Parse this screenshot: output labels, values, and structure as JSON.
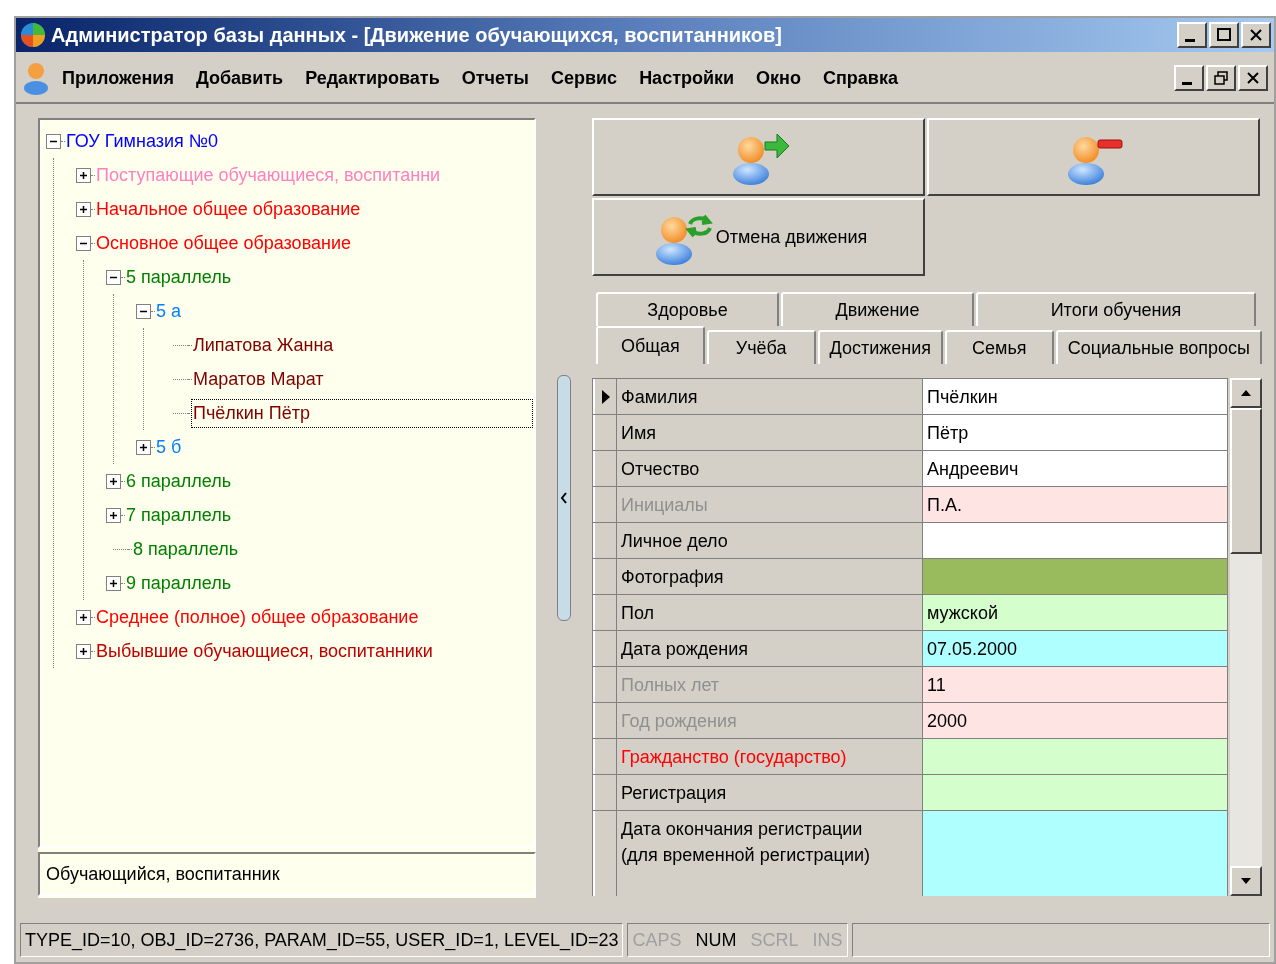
{
  "window": {
    "title": "Администратор базы данных - [Движение обучающихся, воспитанников]"
  },
  "menu": [
    "Приложения",
    "Добавить",
    "Редактировать",
    "Отчеты",
    "Сервис",
    "Настройки",
    "Окно",
    "Справка"
  ],
  "tree": [
    {
      "label": "ГОУ Гимназия №0",
      "color": "#0000ff",
      "expanded": true,
      "selected": false,
      "children": [
        {
          "label": "Поступающие обучающиеся, воспитанни",
          "color": "#ff80c0",
          "expanded": false,
          "selected": false
        },
        {
          "label": "Начальное общее образование",
          "color": "#ff0000",
          "expanded": false,
          "selected": false
        },
        {
          "label": "Основное общее образование",
          "color": "#ff0000",
          "expanded": true,
          "selected": false,
          "children": [
            {
              "label": "5 параллель",
              "color": "#008000",
              "expanded": true,
              "selected": false,
              "children": [
                {
                  "label": "5 а",
                  "color": "#0080ff",
                  "expanded": true,
                  "selected": false,
                  "children": [
                    {
                      "label": "Липатова Жанна",
                      "color": "#800000",
                      "selected": false
                    },
                    {
                      "label": "Маратов Марат",
                      "color": "#800000",
                      "selected": false
                    },
                    {
                      "label": "Пчёлкин Пётр",
                      "color": "#800000",
                      "selected": true
                    }
                  ]
                },
                {
                  "label": "5 б",
                  "color": "#0080ff",
                  "expanded": false,
                  "selected": false
                }
              ]
            },
            {
              "label": "6 параллель",
              "color": "#008000",
              "expanded": false,
              "selected": false
            },
            {
              "label": "7 параллель",
              "color": "#008000",
              "expanded": false,
              "selected": false
            },
            {
              "label": "8 параллель",
              "color": "#008000",
              "selected": false
            },
            {
              "label": "9 параллель",
              "color": "#008000",
              "expanded": false,
              "selected": false
            }
          ]
        },
        {
          "label": "Среднее (полное) общее образование",
          "color": "#ff0000",
          "expanded": false,
          "selected": false
        },
        {
          "label": "Выбывшие обучающиеся, воспитанники",
          "color": "#c00000",
          "expanded": false,
          "selected": false
        }
      ]
    }
  ],
  "tree_footer": {
    "value": "Обучающийся, воспитанник"
  },
  "action_buttons": [
    {
      "kind": "move"
    },
    {
      "kind": "remove"
    },
    {
      "kind": "cancel",
      "label": "Отмена движения"
    }
  ],
  "tabs_top": [
    {
      "label": "Здоровье",
      "selected": false
    },
    {
      "label": "Движение",
      "selected": false
    },
    {
      "label": "Итоги обучения",
      "selected": false
    }
  ],
  "tabs_bottom": [
    {
      "label": "Общая",
      "selected": true
    },
    {
      "label": "Учёба",
      "selected": false
    },
    {
      "label": "Достижения",
      "selected": false
    },
    {
      "label": "Семья",
      "selected": false
    },
    {
      "label": "Социальные вопросы",
      "selected": false
    }
  ],
  "fields": [
    {
      "label": "Фамилия",
      "value": "Пчёлкин",
      "kind": "normal",
      "color": "#ffffff",
      "current": true
    },
    {
      "label": "Имя",
      "value": "Пётр",
      "kind": "normal",
      "color": "#ffffff",
      "current": false
    },
    {
      "label": "Отчество",
      "value": "Андреевич",
      "kind": "normal",
      "color": "#ffffff",
      "current": false
    },
    {
      "label": "Инициалы",
      "value": "П.А.",
      "kind": "readonly",
      "color": "#ffe4e4",
      "current": false
    },
    {
      "label": "Личное дело",
      "kind": "normal",
      "color": "#ffffff",
      "current": false
    },
    {
      "label": "Фотография",
      "kind": "normal",
      "color": "#99bb5e",
      "current": false
    },
    {
      "label": "Пол",
      "value": "мужской",
      "kind": "normal",
      "color": "#d4ffcc",
      "current": false
    },
    {
      "label": "Дата рождения",
      "value": "07.05.2000",
      "kind": "normal",
      "color": "#b0ffff",
      "current": false
    },
    {
      "label": "Полных лет",
      "value": "11",
      "kind": "readonly",
      "color": "#ffe4e4",
      "current": false
    },
    {
      "label": "Год рождения",
      "value": "2000",
      "kind": "readonly",
      "color": "#ffe4e4",
      "current": false
    },
    {
      "label": "Гражданство (государство)",
      "kind": "required",
      "color": "#d4ffcc",
      "current": false
    },
    {
      "label": "Регистрация",
      "kind": "normal",
      "color": "#d4ffcc",
      "current": false
    },
    {
      "label": "Дата окончания регистрации (для временной регистрации)",
      "kind": "normal",
      "color": "#b0ffff",
      "current": false
    }
  ],
  "status_bar": {
    "text": "TYPE_ID=10, OBJ_ID=2736, PARAM_ID=55, USER_ID=1, LEVEL_ID=23",
    "indicators": [
      {
        "label": "CAPS",
        "on": false
      },
      {
        "label": "NUM",
        "on": true
      },
      {
        "label": "SCRL",
        "on": false
      },
      {
        "label": "INS",
        "on": false
      }
    ]
  }
}
